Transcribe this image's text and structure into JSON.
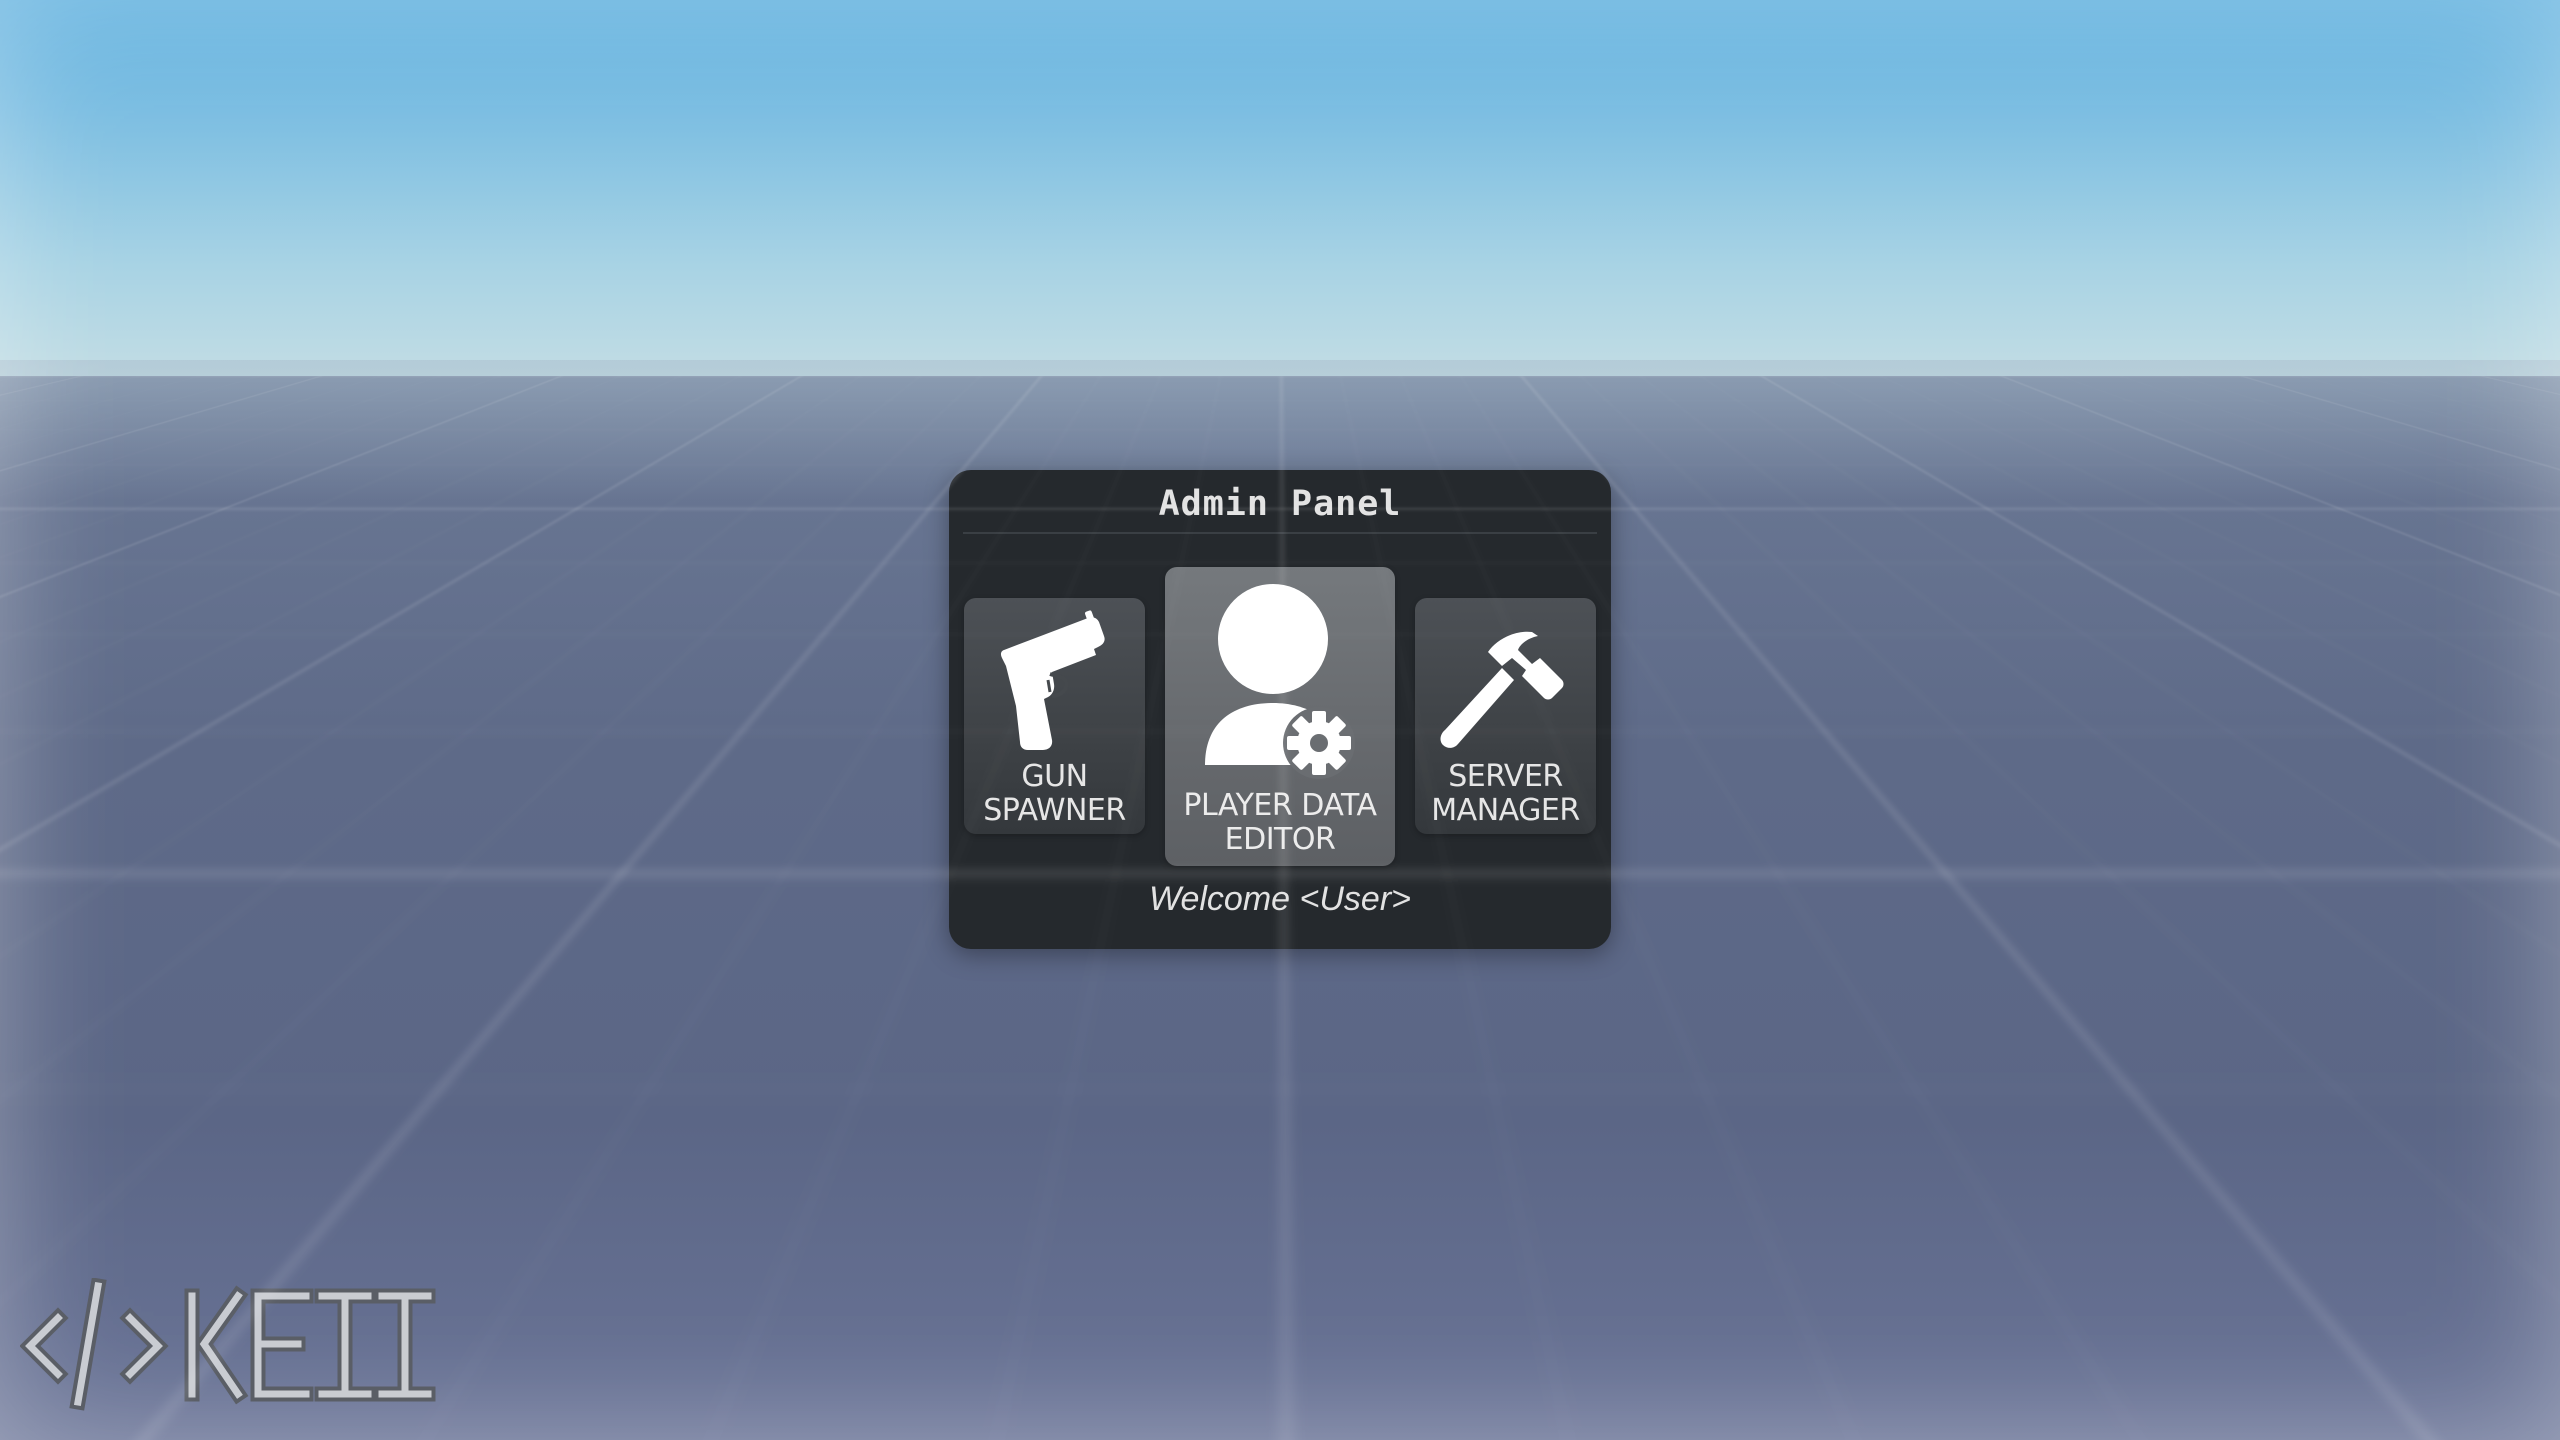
{
  "panel": {
    "title": "Admin Panel",
    "welcome": "Welcome <User>"
  },
  "tools": [
    {
      "label_line1": "GUN",
      "label_line2": "SPAWNER",
      "icon": "pistol-icon",
      "active": false
    },
    {
      "label_line1": "PLAYER DATA",
      "label_line2": "EDITOR",
      "icon": "user-gear-icon",
      "active": true
    },
    {
      "label_line1": "SERVER",
      "label_line2": "MANAGER",
      "icon": "hammer-icon",
      "active": false
    }
  ],
  "branding": {
    "logo_text": "</>KEII"
  },
  "colors": {
    "panel_bg": "#25292d",
    "tool_bg": "#45494d",
    "tool_active_bg": "#6a6d71",
    "text": "#e6e6e6"
  }
}
